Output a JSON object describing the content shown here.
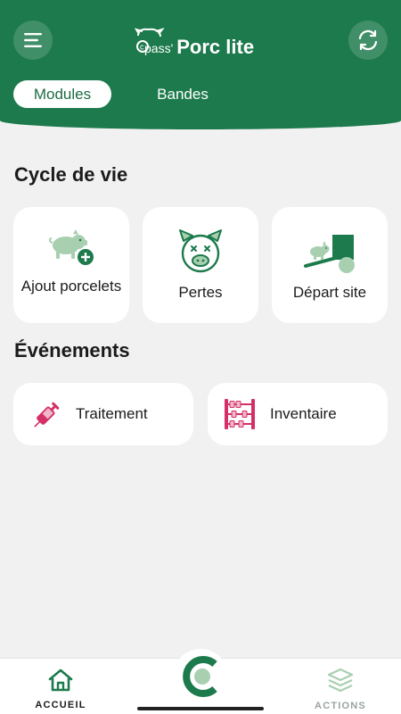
{
  "header": {
    "logo_prefix": "pass'",
    "logo_name": "Porc lite",
    "tabs": [
      {
        "label": "Modules",
        "active": true
      },
      {
        "label": "Bandes",
        "active": false
      }
    ],
    "menu_icon": "menu-icon",
    "sync_icon": "sync-icon"
  },
  "sections": {
    "cycle_title": "Cycle de vie",
    "events_title": "Événements"
  },
  "cycle_cards": [
    {
      "label": "Ajout porcelets",
      "icon": "pig-add-icon"
    },
    {
      "label": "Pertes",
      "icon": "pig-dead-icon"
    },
    {
      "label": "Départ site",
      "icon": "pig-loading-icon"
    }
  ],
  "event_cards": [
    {
      "label": "Traitement",
      "icon": "syringe-icon"
    },
    {
      "label": "Inventaire",
      "icon": "abacus-icon"
    }
  ],
  "bottom_nav": {
    "home_label": "ACCUEIL",
    "actions_label": "ACTIONS"
  },
  "colors": {
    "brand_green": "#1c7a4c",
    "light_green": "#a9cfb1",
    "accent_pink": "#d42f66"
  }
}
